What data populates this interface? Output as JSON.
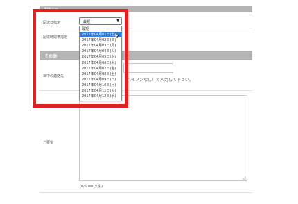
{
  "sections": {
    "delivery_title": "配送指定",
    "other_title": "その他"
  },
  "rows": {
    "delivery_date_label": "配送日指定",
    "delivery_time_label": "配達時間帯指定",
    "daytime_contact_label": "日中の連絡先",
    "request_label": "ご要望"
  },
  "delivery_date_select": {
    "value": "最短",
    "options": [
      "最短",
      "2017年04月01日(土)",
      "2017年04月02日(日)",
      "2017年04月03日(月)",
      "2017年04月04日(火)",
      "2017年04月05日(水)",
      "2017年04月06日(木)",
      "2017年04月07日(金)",
      "2017年04月08日(土)",
      "2017年04月09日(日)",
      "2017年04月10日(月)",
      "2017年04月11日(火)",
      "2017年04月12日(水)"
    ],
    "highlighted_index": 1
  },
  "phone_hint": "（ハイフンなし）で入力して下さい。",
  "request_counter": "(0/5,000文字)",
  "colors": {
    "section_bar": "#b4b4b4",
    "selected_option": "#2f7fe0",
    "highlight_frame": "#e32020"
  }
}
